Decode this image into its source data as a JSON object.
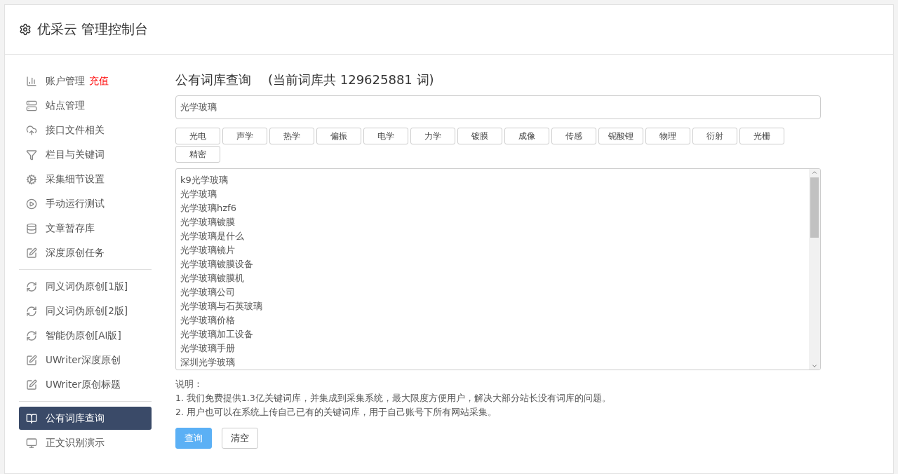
{
  "header": {
    "title": "优采云 管理控制台"
  },
  "sidebar": {
    "groups": [
      {
        "items": [
          {
            "label": "账户管理",
            "badge": "充值",
            "selected": false
          },
          {
            "label": "站点管理",
            "selected": false
          },
          {
            "label": "接口文件相关",
            "selected": false
          },
          {
            "label": "栏目与关键词",
            "selected": false
          },
          {
            "label": "采集细节设置",
            "selected": false
          },
          {
            "label": "手动运行测试",
            "selected": false
          },
          {
            "label": "文章暂存库",
            "selected": false
          },
          {
            "label": "深度原创任务",
            "selected": false
          }
        ]
      },
      {
        "items": [
          {
            "label": "同义词伪原创[1版]",
            "selected": false
          },
          {
            "label": "同义词伪原创[2版]",
            "selected": false
          },
          {
            "label": "智能伪原创[AI版]",
            "selected": false
          },
          {
            "label": "UWriter深度原创",
            "selected": false
          },
          {
            "label": "UWriter原创标题",
            "selected": false
          }
        ]
      },
      {
        "items": [
          {
            "label": "公有词库查询",
            "selected": true
          },
          {
            "label": "正文识别演示",
            "selected": false
          }
        ]
      }
    ]
  },
  "main": {
    "title": "公有词库查询",
    "count_note": "(当前词库共 129625881 词)",
    "search": {
      "value": "光学玻璃"
    },
    "tags": [
      "光电",
      "声学",
      "热学",
      "偏振",
      "电学",
      "力学",
      "镀膜",
      "成像",
      "传感",
      "铌酸锂",
      "物理",
      "衍射",
      "光栅",
      "精密"
    ],
    "results": [
      "k9光学玻璃",
      "光学玻璃",
      "光学玻璃hzf6",
      "光学玻璃镀膜",
      "光学玻璃是什么",
      "光学玻璃镜片",
      "光学玻璃镀膜设备",
      "光学玻璃镀膜机",
      "光学玻璃公司",
      "光学玻璃与石英玻璃",
      "光学玻璃价格",
      "光学玻璃加工设备",
      "光学玻璃手册",
      "深圳光学玻璃"
    ],
    "notes": [
      "说明：",
      "1. 我们免费提供1.3亿关键词库，并集成到采集系统，最大限度方便用户，解决大部分站长没有词库的问题。",
      "2. 用户也可以在系统上传自己已有的关键词库，用于自己账号下所有网站采集。"
    ],
    "buttons": [
      {
        "label": "查询",
        "kind": "primary"
      },
      {
        "label": "清空",
        "kind": "default"
      }
    ]
  }
}
